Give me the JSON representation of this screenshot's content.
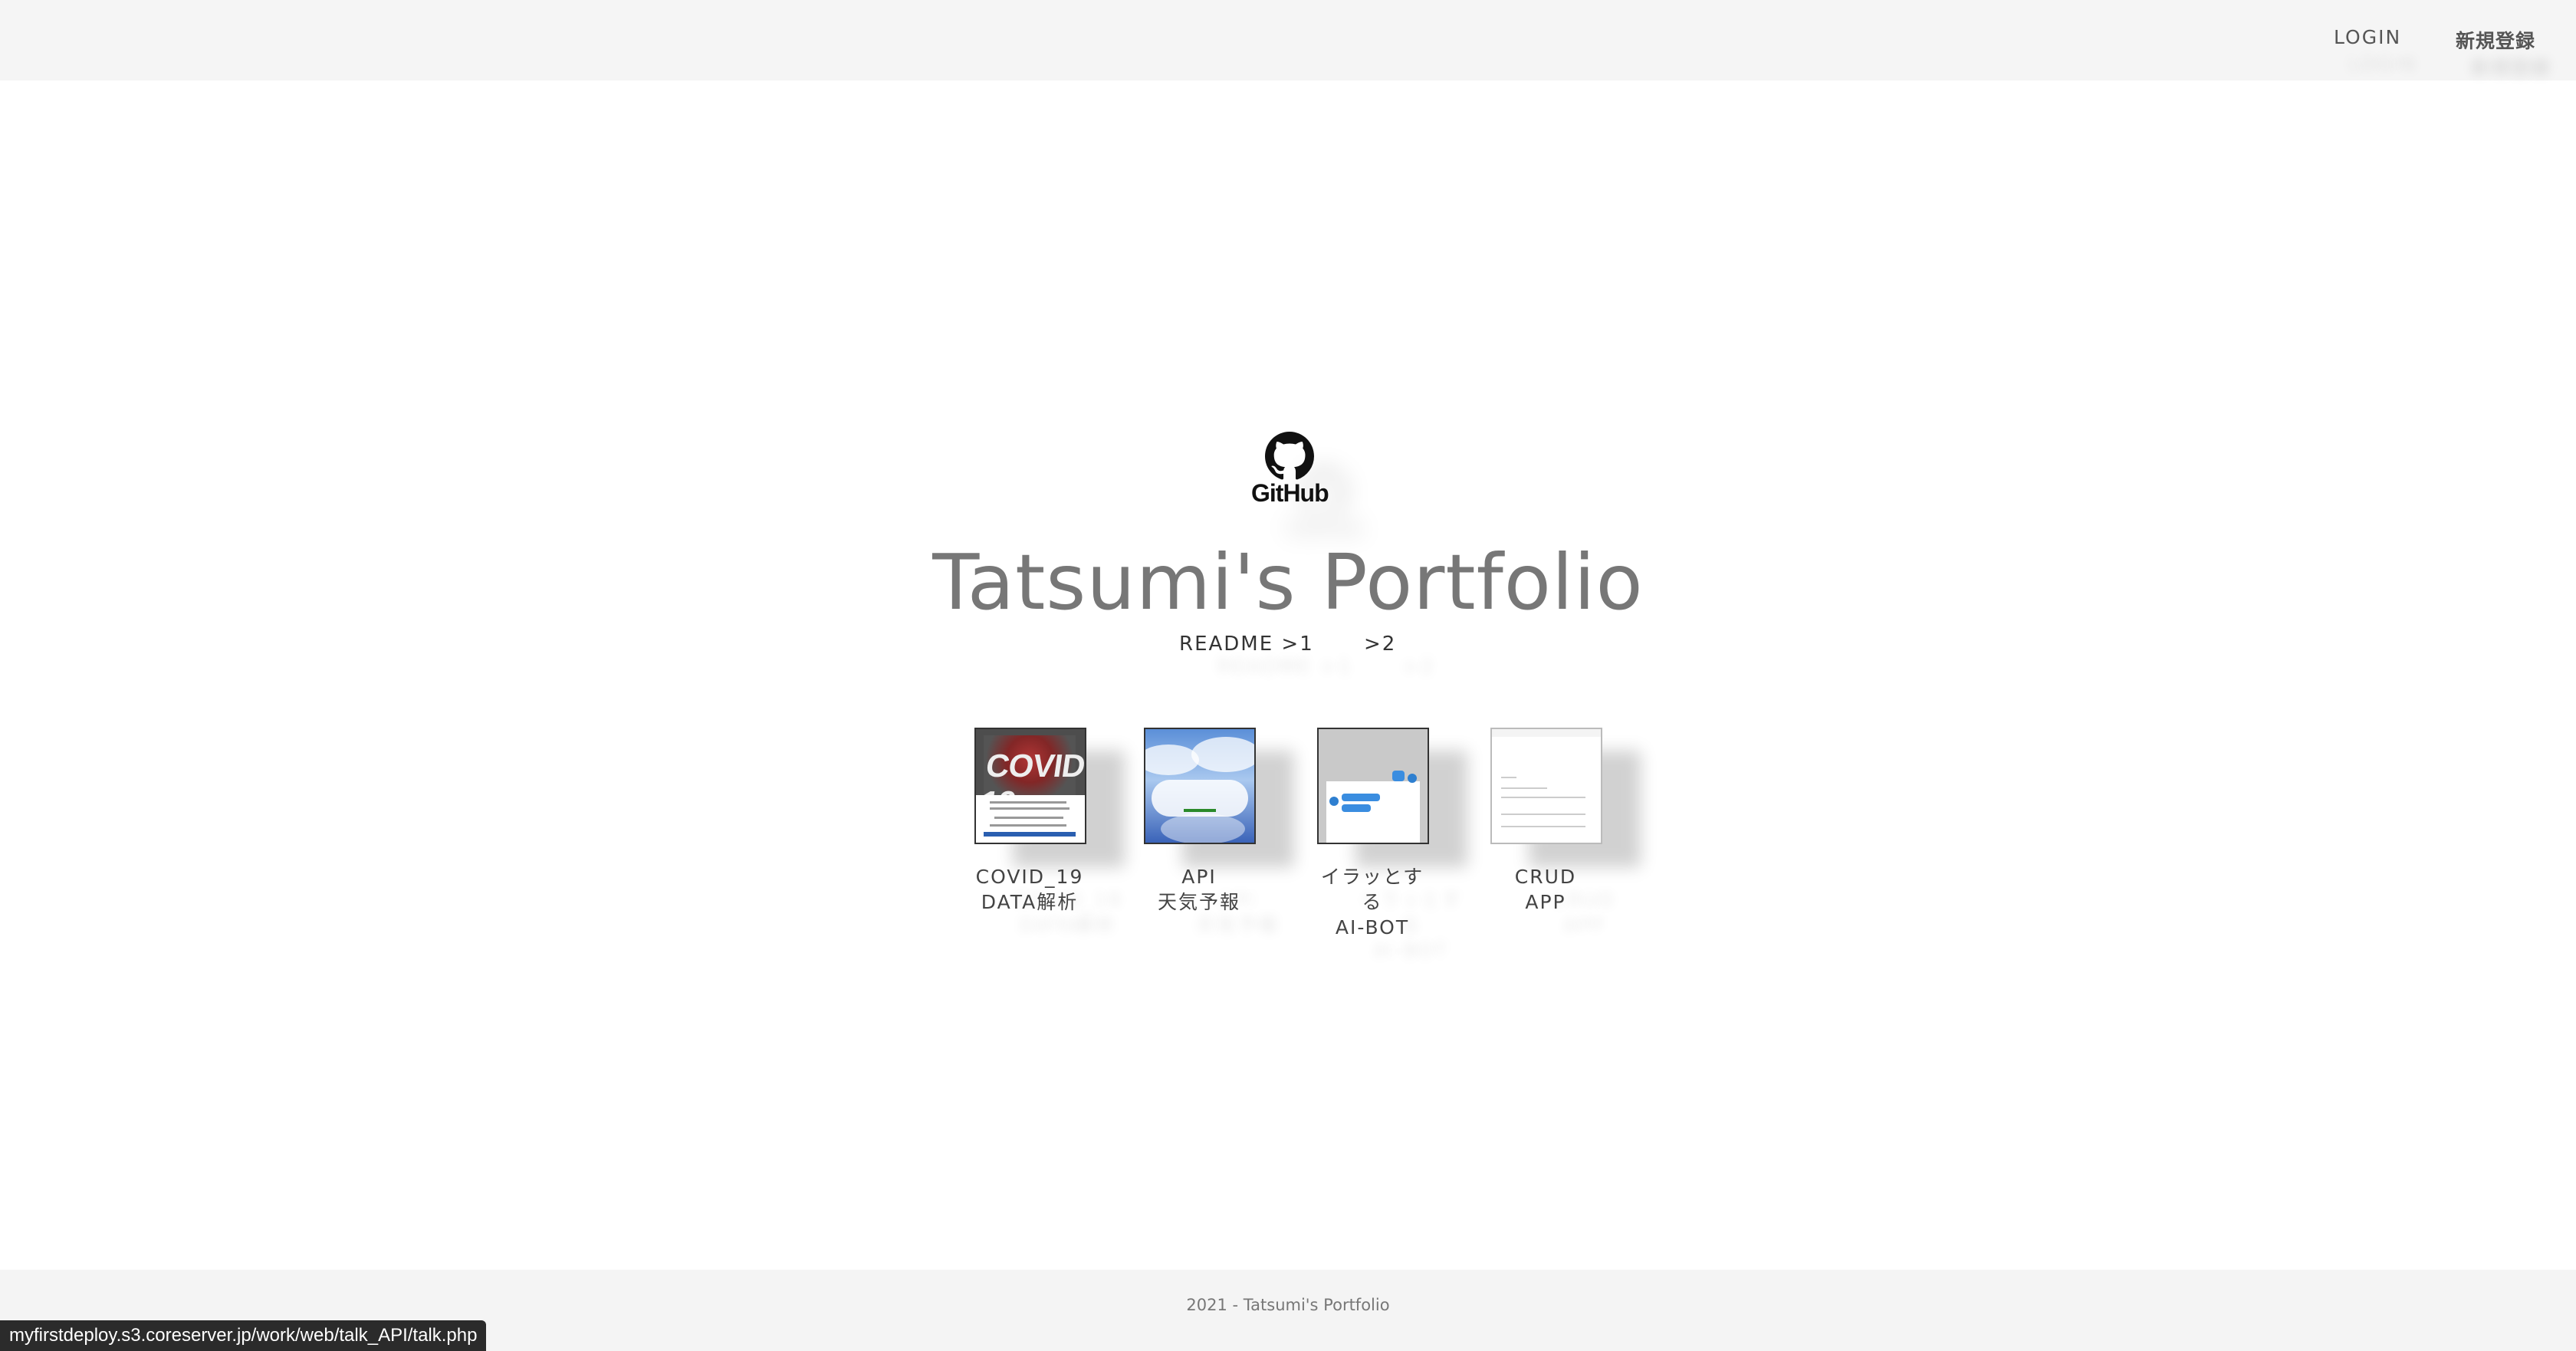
{
  "header": {
    "login_label": "LOGIN",
    "register_label": "新規登録"
  },
  "hero": {
    "logo": {
      "icon": "github-icon",
      "wordmark": "GitHub"
    },
    "title": "Tatsumi's Portfolio",
    "readme_links": [
      {
        "label": "README >1"
      },
      {
        "label": ">2"
      }
    ]
  },
  "projects": [
    {
      "line1": "COVID_19",
      "line2": "DATA解析",
      "thumb_text": "COVID-19"
    },
    {
      "line1": "API",
      "line2": "天気予報"
    },
    {
      "line1": "イラッとする",
      "line2": "AI-BOT"
    },
    {
      "line1": "CRUD",
      "line2": "APP"
    }
  ],
  "footer": {
    "text": "2021 - Tatsumi's Portfolio"
  },
  "status_bar": {
    "url": "myfirstdeploy.s3.coreserver.jp/work/web/talk_API/talk.php"
  },
  "colors": {
    "topbar": "#f5f5f5",
    "title": "#777777",
    "footer": "#f4f4f4",
    "status_bar": "#2b2b2b"
  }
}
